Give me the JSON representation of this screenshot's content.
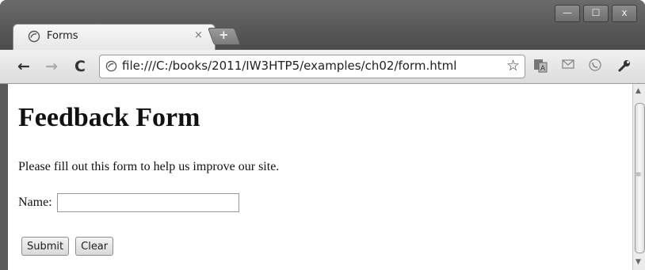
{
  "window": {
    "controls": {
      "minimize": "—",
      "maximize": "☐",
      "close": "x"
    }
  },
  "tab": {
    "title": "Forms",
    "close": "×",
    "new_tab": "+"
  },
  "toolbar": {
    "back": "←",
    "forward": "→",
    "reload": "C",
    "url": "file:///C:/books/2011/IW3HTP5/examples/ch02/form.html",
    "star": "☆",
    "extensions": [
      "translate-icon",
      "mail-icon",
      "phone-icon",
      "wrench-icon"
    ]
  },
  "page": {
    "heading": "Feedback Form",
    "intro": "Please fill out this form to help us improve our site.",
    "name_label": "Name:",
    "name_value": "",
    "submit_label": "Submit",
    "clear_label": "Clear"
  }
}
